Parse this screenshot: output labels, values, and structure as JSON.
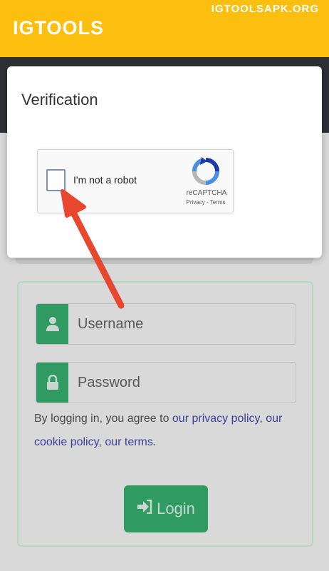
{
  "app": {
    "title": "IGTOOLS",
    "watermark": "IGTOOLSAPK.ORG"
  },
  "dialog": {
    "title": "Verification",
    "recaptcha": {
      "checkbox_label": "I'm not a robot",
      "brand": "reCAPTCHA",
      "links": "Privacy - Terms",
      "checked": false
    }
  },
  "login": {
    "username_placeholder": "Username",
    "password_placeholder": "Password",
    "consent_prefix": "By logging in, you agree to ",
    "privacy_link": "our privacy policy",
    "sep1": ", ",
    "cookie_link": "our cookie policy",
    "sep2": ", ",
    "terms_link": "our terms",
    "end": ".",
    "button_label": "Login"
  },
  "colors": {
    "appbar": "#fcbf0f",
    "accent_green": "#2f9a61",
    "arrow_red": "#e8472f",
    "link": "#3a3f9a"
  }
}
